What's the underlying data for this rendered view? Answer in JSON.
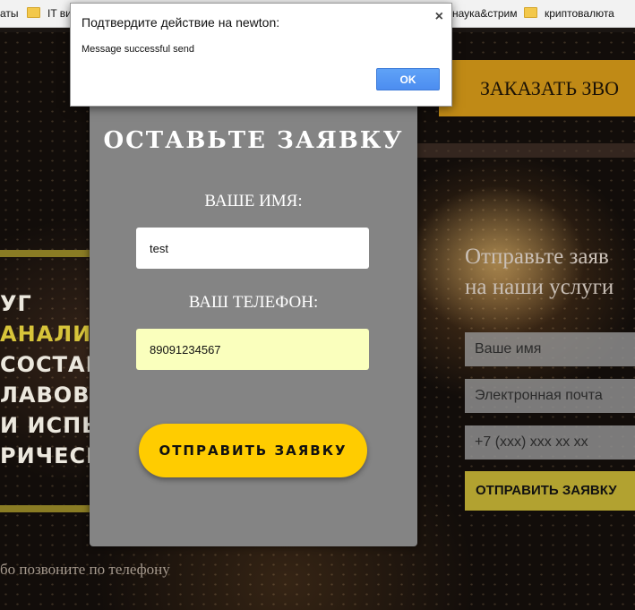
{
  "bookmarks": {
    "items": [
      {
        "label": "аты",
        "icon": "none"
      },
      {
        "label": "IT ви",
        "icon": "folder-icon"
      },
      {
        "label": "наука&стрим",
        "icon": "folder-icon"
      },
      {
        "label": "криптовалюта",
        "icon": "folder-icon"
      }
    ]
  },
  "dialog": {
    "title": "Подтвердите действие на newton:",
    "message": "Message successful send",
    "ok_label": "OK",
    "close_glyph": "×"
  },
  "modal": {
    "title": "ОСТАВЬТЕ ЗАЯВКУ",
    "name_label": "ВАШЕ ИМЯ:",
    "name_value": "test",
    "phone_label": "ВАШ ТЕЛЕФОН:",
    "phone_value": "89091234567",
    "submit_label": "ОТПРАВИТЬ ЗАЯВКУ"
  },
  "page": {
    "order_call_label": "ЗАКАЗАТЬ ЗВО",
    "left_lines": [
      "УГ",
      "АНАЛИЗ",
      "СОСТАВ",
      "ЛАВОВ",
      "И ИСПЫТ",
      "РИЧЕСК"
    ],
    "side_heading_line1": "Отправьте заяв",
    "side_heading_line2": "на наши услуги",
    "side_name_placeholder": "Ваше имя",
    "side_email_placeholder": "Электронная почта",
    "side_phone_placeholder": "+7 (xxx) xxx xx xx",
    "side_submit_label": "ОТПРАВИТЬ ЗАЯВКУ",
    "call_text": "бо позвоните по телефону"
  },
  "colors": {
    "accent": "#ffcc00",
    "dark_accent": "#c08a16",
    "dialog_button": "#4c8df0"
  }
}
